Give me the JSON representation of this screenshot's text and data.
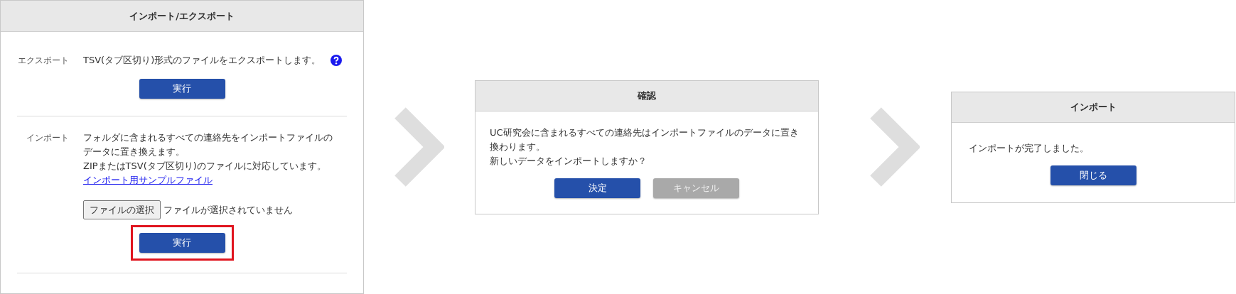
{
  "import_export_panel": {
    "title": "インポート/エクスポート",
    "export": {
      "label": "エクスポート",
      "description": "TSV(タブ区切り)形式のファイルをエクスポートします。",
      "button": {
        "label": "実行",
        "kind": "primary"
      }
    },
    "import": {
      "label": "インポート",
      "lines": [
        "フォルダに含まれるすべての連絡先をインポートファイルのデータに置き換えます。",
        "ZIPまたはTSV(タブ区切り)のファイルに対応しています。"
      ],
      "sample_link": "インポート用サンプルファイル",
      "file_button": "ファイルの選択",
      "file_status": "ファイルが選択されていません",
      "button": {
        "label": "実行",
        "kind": "primary",
        "highlighted": true
      }
    }
  },
  "confirm_dialog": {
    "title": "確認",
    "lines": [
      "UC研究会に含まれるすべての連絡先はインポートファイルのデータに置き換わります。",
      "新しいデータをインポートしますか？"
    ],
    "buttons": [
      {
        "label": "決定",
        "kind": "primary"
      },
      {
        "label": "キャンセル",
        "kind": "secondary"
      }
    ]
  },
  "complete_dialog": {
    "title": "インポート",
    "message": "インポートが完了しました。",
    "buttons": [
      {
        "label": "閉じる",
        "kind": "primary"
      }
    ]
  }
}
